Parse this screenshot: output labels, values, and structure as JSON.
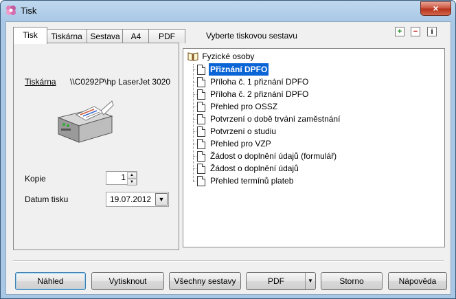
{
  "window": {
    "title": "Tisk",
    "close_label": "×"
  },
  "tabs": [
    "Tisk",
    "Tiskárna",
    "Sestava",
    "A4",
    "PDF"
  ],
  "report_header": "Vyberte tiskovou sestavu",
  "header_icons": [
    "plus-icon",
    "minus-icon",
    "info-icon"
  ],
  "printer": {
    "label": "Tiskárna",
    "name": "\\\\C0292P\\hp LaserJet 3020"
  },
  "copies": {
    "label": "Kopie",
    "value": "1"
  },
  "print_date": {
    "label": "Datum tisku",
    "value": "19.07.2012"
  },
  "tree": {
    "root": "Fyzické osoby",
    "items": [
      "Přiznání DPFO",
      "Příloha č. 1 přiznání DPFO",
      "Příloha č. 2 přiznání DPFO",
      "Přehled pro OSSZ",
      "Potvrzení o době trvání zaměstnání",
      "Potvrzení o studiu",
      "Přehled pro VZP",
      "Žádost o doplnění údajů (formulář)",
      "Žádost o doplnění údajů",
      "Přehled termínů plateb"
    ],
    "selected_index": 0
  },
  "buttons": {
    "preview": "Náhled",
    "print": "Vytisknout",
    "all_reports": "Všechny sestavy",
    "pdf": "PDF",
    "cancel": "Storno",
    "help": "Nápověda"
  },
  "colors": {
    "accent": "#0a64d6",
    "close": "#c9503a"
  }
}
